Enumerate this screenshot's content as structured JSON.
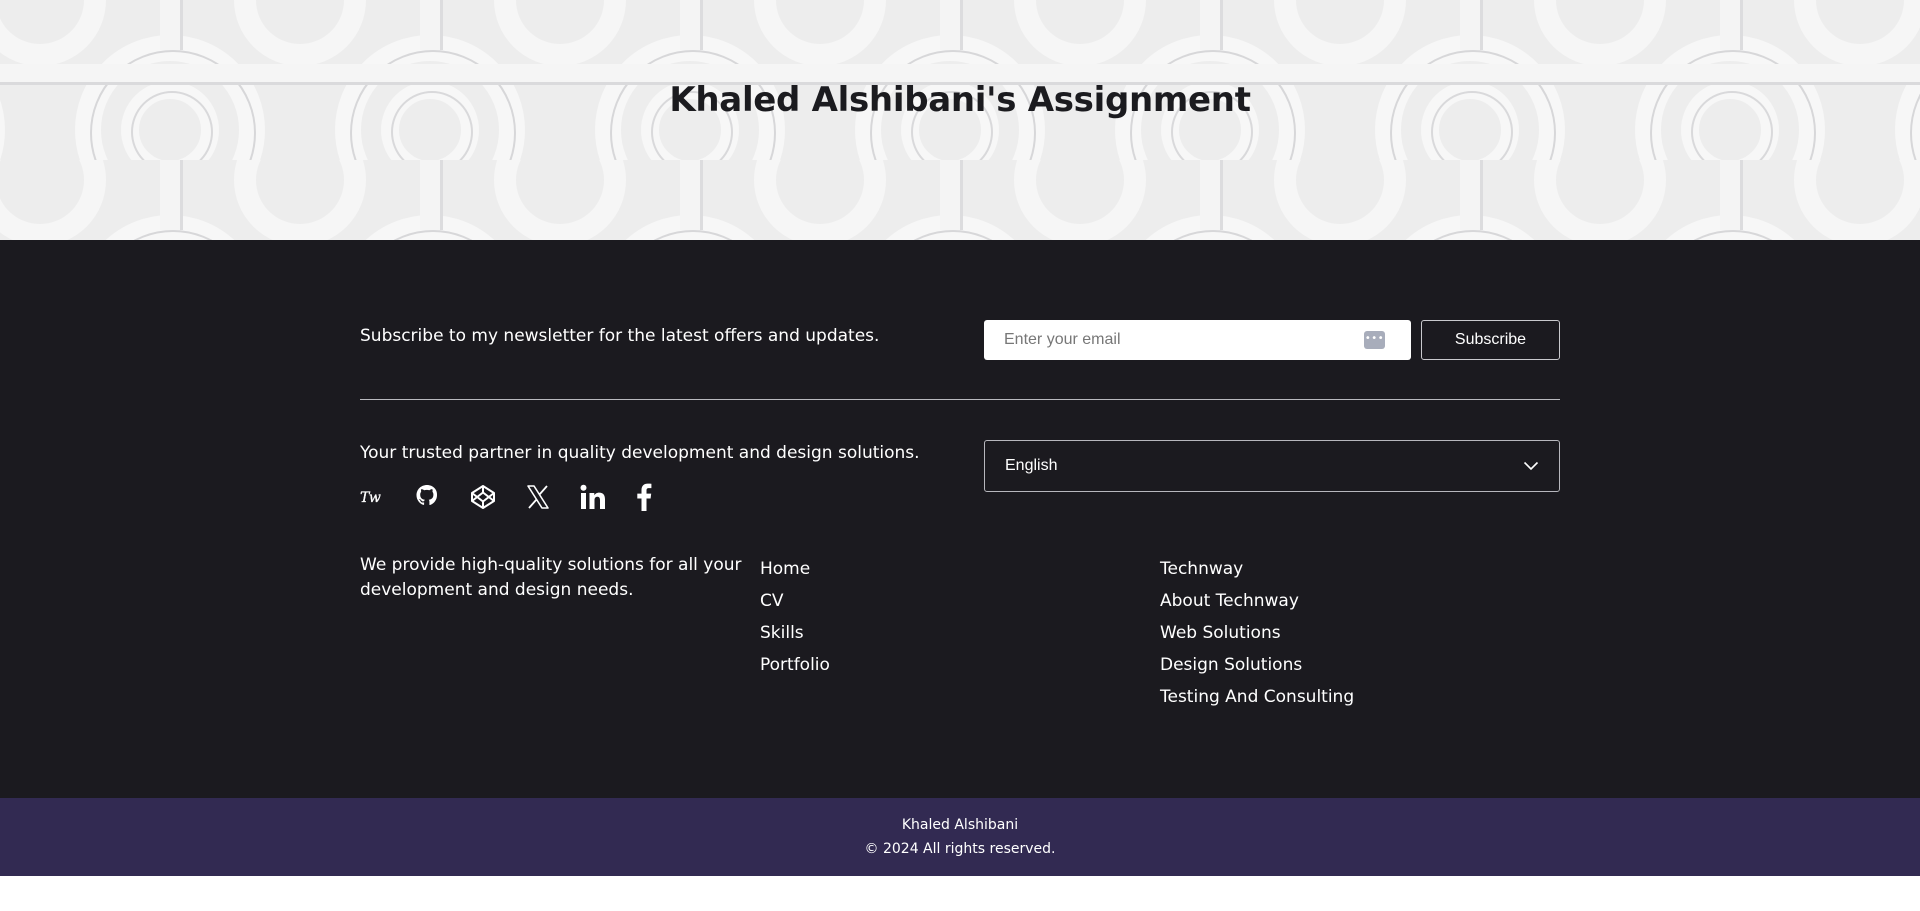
{
  "hero": {
    "title": "Khaled Alshibani's Assignment"
  },
  "newsletter": {
    "text": "Subscribe to my newsletter for the latest offers and updates.",
    "email_placeholder": "Enter your email",
    "subscribe_label": "Subscribe"
  },
  "brand": {
    "tagline": "Your trusted partner in quality development and design solutions.",
    "about": "We provide high-quality solutions for all your development and design needs."
  },
  "social": [
    {
      "icon": "technway-logo-icon",
      "glyph": "Tw"
    },
    {
      "icon": "github-icon"
    },
    {
      "icon": "codepen-icon"
    },
    {
      "icon": "x-twitter-icon"
    },
    {
      "icon": "linkedin-icon"
    },
    {
      "icon": "facebook-icon"
    }
  ],
  "language": {
    "selected": "English"
  },
  "nav_links": [
    "Home",
    "CV",
    "Skills",
    "Portfolio"
  ],
  "company_links": [
    "Technway",
    "About Technway",
    "Web Solutions",
    "Design Solutions",
    "Testing And Consulting"
  ],
  "bottom": {
    "name": "Khaled Alshibani",
    "copyright": "© 2024 All rights reserved."
  },
  "colors": {
    "footer_bg": "#1b1a1f",
    "bottom_bar_bg": "#322a52",
    "hero_bg": "#ececec"
  }
}
